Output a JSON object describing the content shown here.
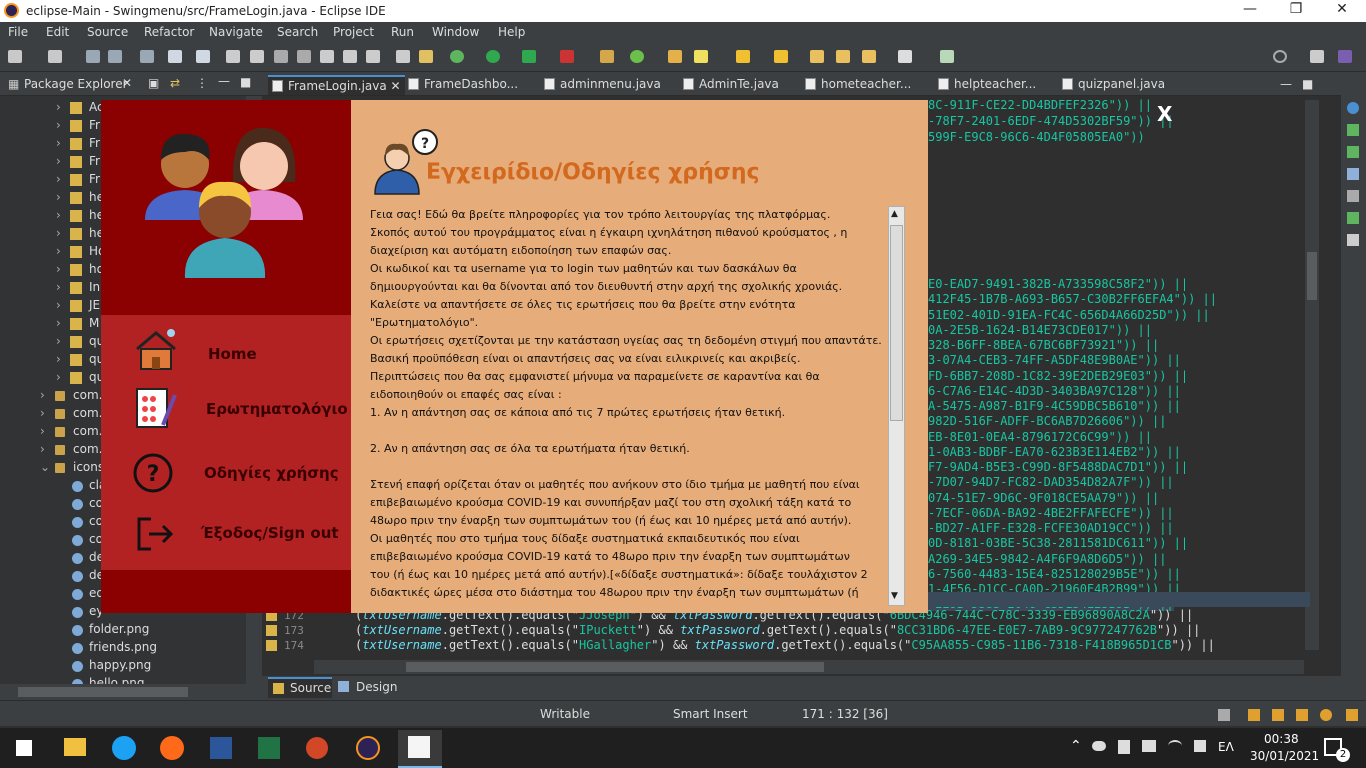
{
  "window": {
    "title": "eclipse-Main - Swingmenu/src/FrameLogin.java - Eclipse IDE"
  },
  "menu": [
    "File",
    "Edit",
    "Source",
    "Refactor",
    "Navigate",
    "Search",
    "Project",
    "Run",
    "Window",
    "Help"
  ],
  "package_explorer": {
    "title": "Package Explorer",
    "items": [
      "Ac",
      "Fr",
      "Fr",
      "Fr",
      "Fr",
      "he",
      "he",
      "he",
      "Ho",
      "ho",
      "In",
      "JE",
      "M",
      "qu",
      "qu",
      "qu"
    ],
    "packages": [
      "com.",
      "com.",
      "com.",
      "com."
    ],
    "icons_folder": "icons",
    "files": [
      "cla",
      "co",
      "co",
      "co",
      "de",
      "de",
      "ed",
      "ey",
      "folder.png",
      "friends.png",
      "happy.png",
      "hello.png"
    ]
  },
  "editor": {
    "tabs": [
      "FrameLogin.java",
      "FrameDashbo...",
      "adminmenu.java",
      "AdminTe.java",
      "hometeacher...",
      "helpteacher...",
      "quizpanel.java"
    ],
    "code_top": [
      "8C-911F-CE22-DD4BDFEF2326\")) ||",
      "-78F7-2401-6EDF-474D5302BF59\")) ||",
      "599F-E9C8-96C6-4D4F05805EA0\"))"
    ],
    "code_right": [
      "E0-EAD7-9491-382B-A733598C58F2\")) ||",
      "412F45-1B7B-A693-B657-C30B2FF6EFA4\")) ||",
      "51E02-401D-91EA-FC4C-656D4A66D25D\")) ||",
      "0A-2E5B-1624-B14E73CDE017\")) ||",
      "328-B6FF-8BEA-67BC6BF73921\")) ||",
      "3-07A4-CEB3-74FF-A5DF48E9B0AE\")) ||",
      "FD-6BB7-208D-1C82-39E2DEB29E03\")) ||",
      "6-C7A6-E14C-4D3D-3403BA97C128\")) ||",
      "A-5475-A987-B1F9-4C59DBC5B610\")) ||",
      "982D-516F-ADFF-BC6AB7D26606\")) ||",
      "EB-8E01-0EA4-8796172C6C99\")) ||",
      "1-0AB3-BDBF-EA70-623B3E114EB2\")) ||",
      "F7-9AD4-B5E3-C99D-8F5488DAC7D1\")) ||",
      "-7D07-94D7-FC82-DAD354D82A7F\")) ||",
      "074-51E7-9D6C-9F018CE5AA79\")) ||",
      "-7ECF-06DA-BA92-4BE2FFAFECFE\")) ||",
      "-BD27-A1FF-E328-FCFE30AD19CC\")) ||",
      "0D-8181-03BE-5C38-2811581DC611\")) ||",
      "A269-34E5-9842-A4F6F9A8D6D5\")) ||",
      "6-7560-4483-15E4-825128029B5E\")) ||",
      "1-4F56-D1CC-CA0D-21960E4B2B99\")) ||",
      "-229B-D583-2048-C3D154E25B9B\")) ||"
    ],
    "bottom_lines": [
      {
        "num": "172",
        "user": "JJoseph",
        "hash": "6BDC4946-744C-C78C-3339-EB96890A8C2A"
      },
      {
        "num": "173",
        "user": "IPuckett",
        "hash": "8CC31BD6-47EE-E0E7-7AB9-9C977247762B"
      },
      {
        "num": "174",
        "user": "HGallagher",
        "hash": "C95AA855-C985-11B6-7318-F418B965D1CB"
      }
    ],
    "code_parts": {
      "username": "txtUsername",
      "password": "txtPassword",
      "gettext": ".getText()",
      "equals": ".equals(\"",
      "and": "&&",
      "or": "||"
    },
    "bottom_tabs": [
      "Source",
      "Design"
    ]
  },
  "status": {
    "mode": "Writable",
    "insert": "Smart Insert",
    "position": "171 : 132 [36]"
  },
  "taskbar": {
    "lang": "ΕΛ",
    "time": "00:38",
    "date": "30/01/2021",
    "notif": "2"
  },
  "dialog": {
    "close": "X",
    "title": "Εγχειρίδιο/Οδηγίες χρήσης",
    "menu": [
      "Home",
      "Ερωτηματολόγιο",
      "Οδηγίες χρήσης",
      "Έξοδος/Sign out"
    ],
    "lines": [
      "Γεια σας! Εδώ θα βρείτε πληροφορίες για τον τρόπο λειτουργίας της πλατφόρμας.",
      "Σκοπός αυτού του προγράμματος είναι η έγκαιρη ιχνηλάτηση πιθανού κρούσματος , η",
      "διαχείριση και αυτόματη ειδοποίηση των επαφών σας.",
      "Οι κωδικοί και τα username για το login των μαθητών και των δασκάλων θα",
      "δημιουργούνται και θα δίνονται από τον διευθυντή στην αρχή της σχολικής χρονιάς.",
      "Καλείστε να απαντήσετε σε όλες τις ερωτήσεις που θα βρείτε στην ενότητα",
      "\"Ερωτηματολόγιο\".",
      "Οι ερωτήσεις σχετίζονται με την κατάσταση υγείας σας τη δεδομένη στιγμή που απαντάτε.",
      "Βασική προϋπόθεση είναι οι απαντήσεις σας να είναι ειλικρινείς και ακριβείς.",
      "Περιπτώσεις που θα σας εμφανιστεί μήνυμα να παραμείνετε σε καραντίνα και θα",
      "ειδοποιηθούν οι επαφές σας είναι :",
      "1. Αν η απάντηση σας σε κάποια από τις 7 πρώτες ερωτήσεις ήταν θετική.",
      "",
      "2. Αν η απάντηση σας σε όλα τα ερωτήματα ήταν θετική.",
      "",
      "Στενή επαφή ορίζεται όταν οι μαθητές που ανήκουν στο ίδιο τμήμα με μαθητή που είναι",
      " επιβεβαιωμένο κρούσμα COVID-19 και συνυπήρξαν μαζί του στη σχολική τάξη κατά το",
      "48ωρο πριν την έναρξη των συμπτωμάτων του (ή έως και 10 ημέρες μετά από αυτήν).",
      "Οι μαθητές που στο τμήμα τους δίδαξε συστηματικά εκπαιδευτικός που είναι",
      "επιβεβαιωμένο κρούσμα COVID-19 κατά το 48ωρο πριν την έναρξη των συμπτωμάτων",
      " του (ή έως και 10 ημέρες μετά από αυτήν).[«δίδαξε συστηματικά»: δίδαξε τουλάχιστον 2",
      " διδακτικές ώρες μέσα στο διάστημα του 48ωρου πριν την έναρξη των συμπτωμάτων (ή"
    ]
  }
}
